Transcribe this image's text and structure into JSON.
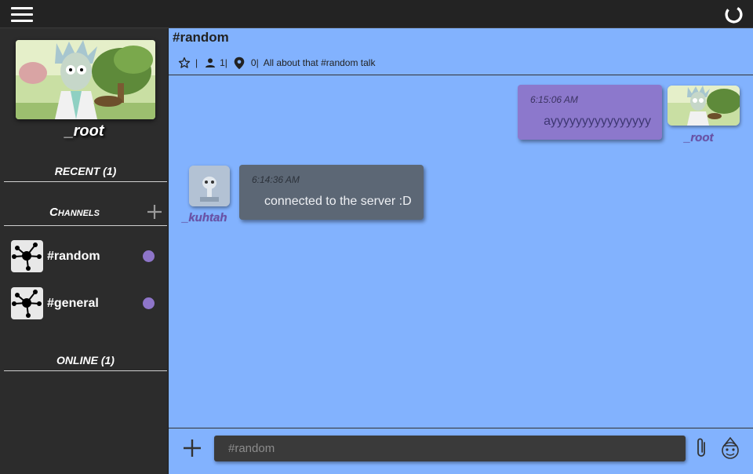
{
  "app": {
    "menu_icon": "hamburger-icon",
    "status_icon": "loading-spinner-icon"
  },
  "sidebar": {
    "profile": {
      "username": "_root"
    },
    "recent": {
      "label": "RECENT",
      "count_text": "(1)"
    },
    "channels": {
      "label": "Channels",
      "add_icon": "plus-icon",
      "items": [
        {
          "name": "#random",
          "icon": "network-icon",
          "indicator_color": "#8e75c9"
        },
        {
          "name": "#general",
          "icon": "network-icon",
          "indicator_color": "#8e75c9"
        }
      ]
    },
    "online": {
      "label": "ONLINE",
      "count_text": "(1)"
    }
  },
  "main": {
    "channel_title": "#random",
    "meta": {
      "favorite_icon": "star-icon",
      "sep1": "|",
      "users_icon": "person-icon",
      "users_count": "1|",
      "pins_icon": "location-pin-icon",
      "pins_count": "0|",
      "topic": "All about that #random talk"
    },
    "messages": [
      {
        "user": "_root",
        "time": "6:15:06 AM",
        "text": "ayyyyyyyyyyyyyyyy",
        "own": true
      },
      {
        "user": "_kuhtah",
        "time": "6:14:36 AM",
        "text": "connected to the server :D",
        "own": false
      }
    ],
    "composer": {
      "placeholder": "#random",
      "add_icon": "plus-icon",
      "attach_icon": "paperclip-icon",
      "emoji_icon": "mascot-emoji-icon"
    }
  },
  "colors": {
    "main_bg": "#82b2fe",
    "sidebar_bg": "#2c2c2c",
    "own_bubble": "#8c78cc",
    "other_bubble": "#5c6775",
    "username": "#6b4fa6"
  }
}
